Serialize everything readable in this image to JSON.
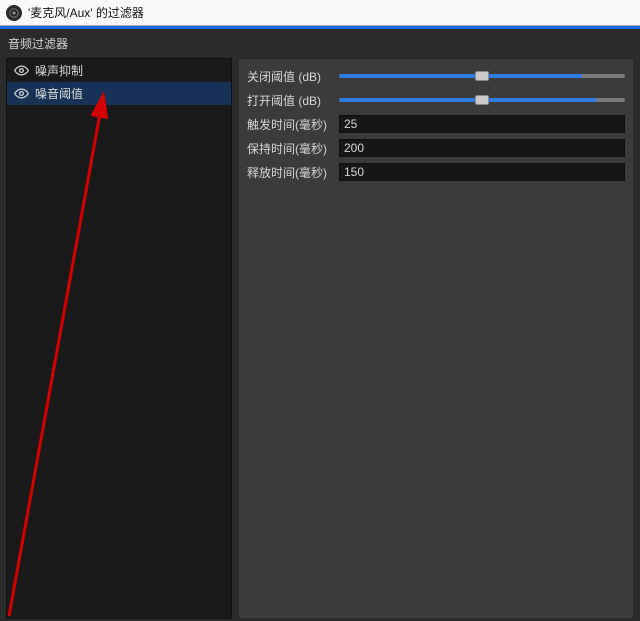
{
  "titlebar": {
    "title": "'麦克风/Aux' 的过滤器"
  },
  "section": {
    "header": "音频过滤器"
  },
  "filters": [
    {
      "label": "噪声抑制",
      "selected": false
    },
    {
      "label": "噪音阈值",
      "selected": true
    }
  ],
  "props": {
    "close_threshold": {
      "label": "关闭阈值 (dB)",
      "fill_pct": 85
    },
    "open_threshold": {
      "label": "打开阈值 (dB)",
      "fill_pct": 90
    },
    "attack": {
      "label": "触发时间(毫秒)",
      "value": "25"
    },
    "hold": {
      "label": "保持时间(毫秒)",
      "value": "200"
    },
    "release": {
      "label": "释放时间(毫秒)",
      "value": "150"
    }
  }
}
